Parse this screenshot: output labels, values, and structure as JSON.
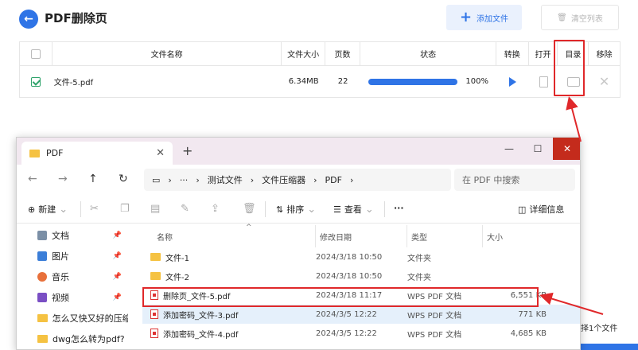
{
  "app": {
    "title": "PDF删除页",
    "add_button": "添加文件",
    "clear_button": "清空列表",
    "columns": [
      "文件名称",
      "文件大小",
      "页数",
      "状态",
      "转换",
      "打开",
      "目录",
      "移除"
    ],
    "row": {
      "name": "文件-5.pdf",
      "size": "6.34MB",
      "pages": "22",
      "progress_text": "100%",
      "progress": 1.0
    },
    "bottom_text": "择1个文件"
  },
  "explorer": {
    "tab_title": "PDF",
    "breadcrumb": [
      "测试文件",
      "文件压缩器",
      "PDF"
    ],
    "search_placeholder": "在 PDF 中搜索",
    "toolbar": {
      "new": "新建",
      "sort": "排序",
      "view": "查看",
      "more": "···",
      "details": "详细信息"
    },
    "sidebar": [
      {
        "label": "文档",
        "icon": "document-icon"
      },
      {
        "label": "图片",
        "icon": "picture-icon"
      },
      {
        "label": "音乐",
        "icon": "music-icon"
      },
      {
        "label": "视频",
        "icon": "video-icon"
      },
      {
        "label": "怎么又快又好的压缩图",
        "icon": "folder-icon"
      },
      {
        "label": "dwg怎么转为pdf?",
        "icon": "folder-icon"
      }
    ],
    "headers": {
      "name": "名称",
      "date": "修改日期",
      "type": "类型",
      "size": "大小"
    },
    "files": [
      {
        "name": "文件-1",
        "date": "2024/3/18 10:50",
        "type": "文件夹",
        "size": "",
        "kind": "folder"
      },
      {
        "name": "文件-2",
        "date": "2024/3/18 10:50",
        "type": "文件夹",
        "size": "",
        "kind": "folder"
      },
      {
        "name": "删除页_文件-5.pdf",
        "date": "2024/3/18 11:17",
        "type": "WPS PDF 文档",
        "size": "6,551 KB",
        "kind": "pdf"
      },
      {
        "name": "添加密码_文件-3.pdf",
        "date": "2024/3/5 12:22",
        "type": "WPS PDF 文档",
        "size": "771 KB",
        "kind": "pdf"
      },
      {
        "name": "添加密码_文件-4.pdf",
        "date": "2024/3/5 12:22",
        "type": "WPS PDF 文档",
        "size": "4,685 KB",
        "kind": "pdf"
      }
    ]
  },
  "colors": {
    "accent": "#2f74e6",
    "highlight": "#e0282a",
    "close": "#c42b1c"
  }
}
